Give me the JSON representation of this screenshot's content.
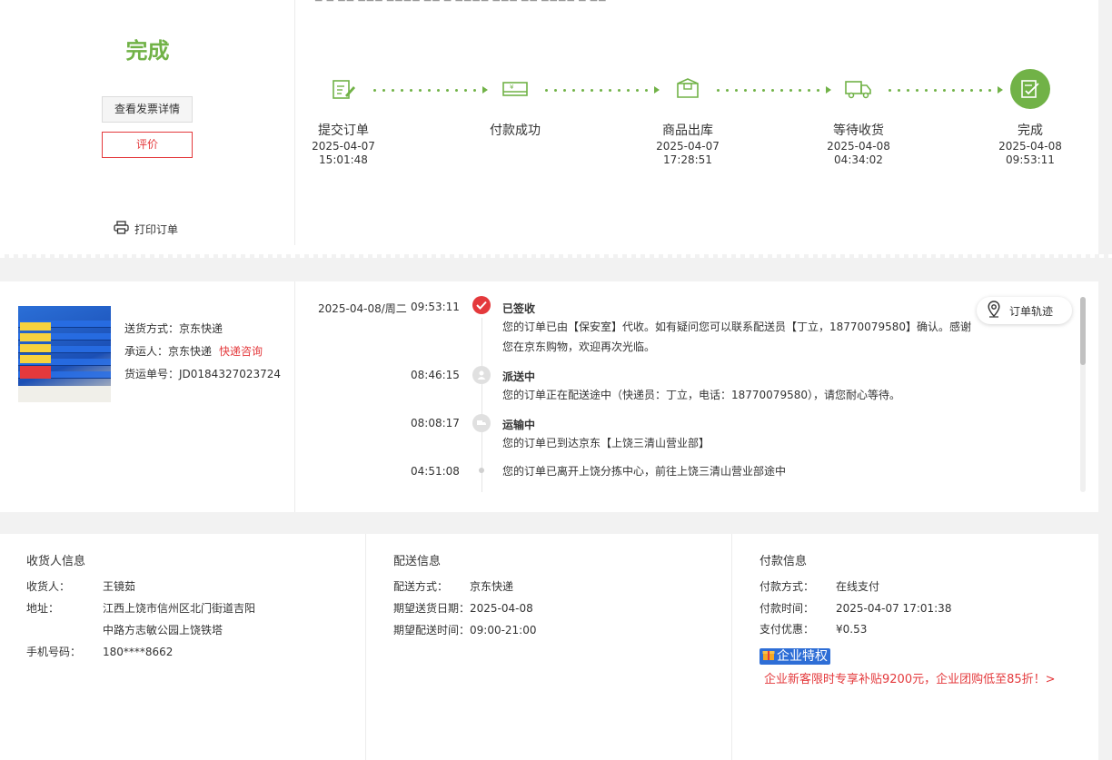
{
  "status": {
    "title": "完成",
    "invoice_button": "查看发票详情",
    "review_button": "评价",
    "print_link": "打印订单"
  },
  "progress": {
    "steps": [
      {
        "label": "提交订单",
        "date": "2025-04-07",
        "time": "15:01:48",
        "icon": "edit-document-icon"
      },
      {
        "label": "付款成功",
        "date": "",
        "time": "",
        "icon": "payment-card-icon"
      },
      {
        "label": "商品出库",
        "date": "2025-04-07",
        "time": "17:28:51",
        "icon": "package-box-icon"
      },
      {
        "label": "等待收货",
        "date": "2025-04-08",
        "time": "04:34:02",
        "icon": "delivery-truck-icon"
      },
      {
        "label": "完成",
        "date": "2025-04-08",
        "time": "09:53:11",
        "icon": "completed-check-icon"
      }
    ],
    "current_step": 5
  },
  "shipping": {
    "method_label": "送货方式：京东快递",
    "carrier_label": "承运人：京东快递",
    "carrier_link": "快递咨询",
    "tracking_label": "货运单号：JD0184327023724"
  },
  "tracking": {
    "date": "2025-04-08/周二",
    "button": "订单轨迹",
    "events": [
      {
        "time": "09:53:11",
        "title": "已签收",
        "text": "您的订单已由【保安室】代收。如有疑问您可以联系配送员【丁立，18770079580】确认。感谢您在京东购物，欢迎再次光临。",
        "icon": "signed-check-icon"
      },
      {
        "time": "08:46:15",
        "title": "派送中",
        "text": "您的订单正在配送途中（快递员：丁立，电话：18770079580），请您耐心等待。",
        "icon": "courier-icon"
      },
      {
        "time": "08:08:17",
        "title": "运输中",
        "text": "您的订单已到达京东【上饶三清山营业部】",
        "icon": "transport-icon"
      },
      {
        "time": "04:51:08",
        "title": "",
        "text": "您的订单已离开上饶分拣中心，前往上饶三清山营业部途中",
        "icon": "dot-icon"
      }
    ]
  },
  "receiver": {
    "heading": "收货人信息",
    "name_key": "收货人：",
    "name_value": "王镜茹",
    "address_key": "地址：",
    "address_line1": "江西上饶市信州区北门街道吉阳",
    "address_line2": "中路方志敏公园上饶铁塔",
    "phone_key": "手机号码：",
    "phone_value": "180****8662"
  },
  "delivery": {
    "heading": "配送信息",
    "method_key": "配送方式：",
    "method_value": "京东快递",
    "date_line": "期望送货日期：2025-04-08",
    "time_line": "期望配送时间：09:00-21:00"
  },
  "payment": {
    "heading": "付款信息",
    "method_key": "付款方式：",
    "method_value": "在线支付",
    "time_key": "付款时间：",
    "time_value": "2025-04-07 17:01:38",
    "discount_key": "支付优惠：",
    "discount_value": "¥0.53",
    "enterprise_badge": "企业特权",
    "enterprise_promo": "企业新客限时专享补贴9200元，企业团购低至85折！>"
  },
  "colors": {
    "accent_green": "#71b247",
    "accent_red": "#e4393c",
    "enterprise_blue": "#2e6ed6"
  }
}
